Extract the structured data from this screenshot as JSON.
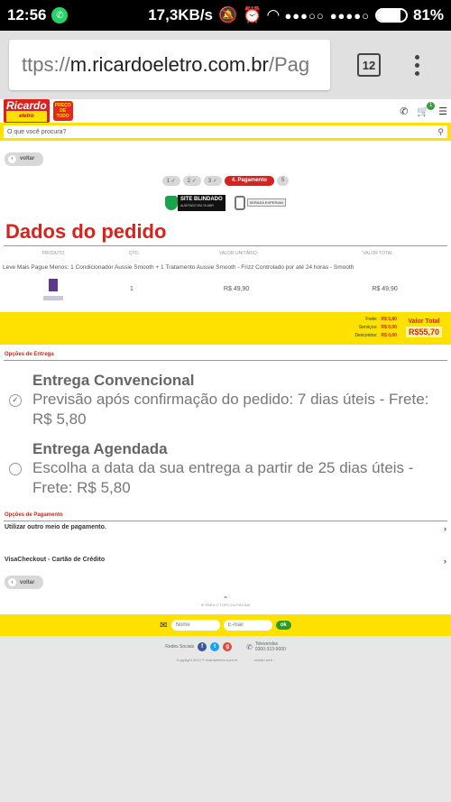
{
  "status_bar": {
    "time": "12:56",
    "network_speed": "17,3KB/s",
    "signal_1": "●●●○○",
    "signal_2": "●●●●○",
    "battery_percent": "81%",
    "battery_level": 0.81
  },
  "browser": {
    "url_prefix": "ttps://",
    "url_host": "m.ricardoeletro.com.br",
    "url_suffix": "/Pag",
    "tab_count": "12"
  },
  "site": {
    "logo_text": "Ricardo",
    "logo_sub": "eletro",
    "badge_text": "PREÇO DE TUDO",
    "cart_count": "1",
    "search_placeholder": "O que você procura?"
  },
  "nav": {
    "back_label": "voltar",
    "steps": [
      "1 ✓",
      "2 ✓",
      "3 ✓",
      "4. Pagamento",
      "5"
    ]
  },
  "seals": {
    "seal1_title": "SITE BLINDADO",
    "seal1_sub": "AUDITADO EM 19 ABR",
    "seal2_text": "SERASA EXPERIAN"
  },
  "order": {
    "title": "Dados do pedido",
    "headers": [
      "PRODUTO",
      "QTD.",
      "VALOR UNITÁRIO",
      "VALOR TOTAL"
    ],
    "product_desc": "Leve Mais Pague Menos: 1 Condicionador Aussie Smooth + 1 Tratamento Aussie Smooth - Frizz Controlado por até 24 horas - Smooth",
    "qty": "1",
    "unit_price": "R$ 49,90",
    "total_price": "R$ 49,90"
  },
  "totals": {
    "frete_label": "Frete:",
    "frete_value": "R$ 5,80",
    "servicos_label": "Serviços:",
    "servicos_value": "R$ 0,00",
    "descontos_label": "Descontos:",
    "descontos_value": "R$ 0,00",
    "total_label": "Valor Total",
    "total_value": "R$55,70"
  },
  "shipping": {
    "section_title": "Opções de Entrega",
    "options": [
      {
        "title": "Entrega Convencional",
        "desc": "Previsão após confirmação do pedido: 7 dias úteis - Frete: R$ 5,80",
        "selected": true
      },
      {
        "title": "Entrega Agendada",
        "desc": "Escolha a data da sua entrega a partir de 25 dias úteis - Frete: R$ 5,80",
        "selected": false
      }
    ]
  },
  "payment": {
    "section_title": "Opções de Pagamento",
    "option_1": "Utilizar outro meio de pagamento.",
    "option_2": "VisaCheckout - Cartão de Crédito"
  },
  "footer": {
    "back_to_top": "IR PARA O TOPO DA PÁGINA",
    "name_placeholder": "Nome",
    "email_placeholder": "E-mail",
    "ok_label": "ok",
    "social_label": "Redes Sociais",
    "tele_label": "Televendas",
    "tele_number": "0300-313-9000",
    "copyright": "Copyright 2012 © ricardoeletro.com.br",
    "web_version": "versão web"
  },
  "colors": {
    "brand_red": "#d9221c",
    "brand_yellow": "#ffe100",
    "ok_green": "#2a9a2a"
  }
}
